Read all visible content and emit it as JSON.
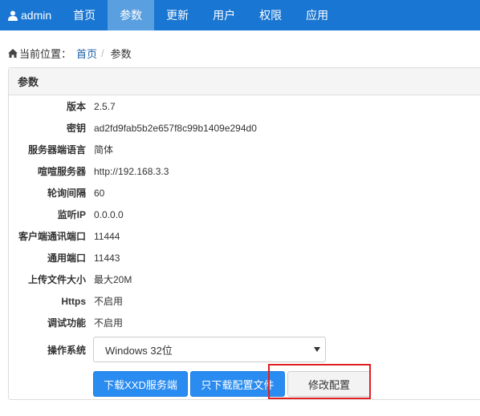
{
  "navbar": {
    "brand": "admin",
    "items": [
      {
        "label": "首页",
        "active": false
      },
      {
        "label": "参数",
        "active": true
      },
      {
        "label": "更新",
        "active": false
      },
      {
        "label": "用户",
        "active": false
      },
      {
        "label": "权限",
        "active": false
      },
      {
        "label": "应用",
        "active": false
      }
    ]
  },
  "breadcrumb": {
    "prefix": "当前位置：",
    "home": "首页",
    "separator": "/",
    "current": "参数"
  },
  "panel": {
    "title": "参数",
    "rows": [
      {
        "label": "版本",
        "value": "2.5.7"
      },
      {
        "label": "密钥",
        "value": "ad2fd9fab5b2e657f8c99b1409e294d0"
      },
      {
        "label": "服务器端语言",
        "value": "简体"
      },
      {
        "label": "喧喧服务器",
        "value": "http://192.168.3.3"
      },
      {
        "label": "轮询间隔",
        "value": "60"
      },
      {
        "label": "监听IP",
        "value": "0.0.0.0"
      },
      {
        "label": "客户端通讯端口",
        "value": "11444"
      },
      {
        "label": "通用端口",
        "value": "11443"
      },
      {
        "label": "上传文件大小",
        "value": "最大20M"
      },
      {
        "label": "Https",
        "value": "不启用"
      },
      {
        "label": "调试功能",
        "value": "不启用"
      }
    ],
    "os": {
      "label": "操作系统",
      "selected": "Windows 32位"
    },
    "buttons": {
      "download_server": "下载XXD服务端",
      "download_config": "只下载配置文件",
      "edit_config": "修改配置"
    }
  },
  "colors": {
    "navbar": "#1976d2",
    "nav_active": "#5a9fe0",
    "primary_button": "#2a8cf0",
    "highlight": "#e02020"
  }
}
